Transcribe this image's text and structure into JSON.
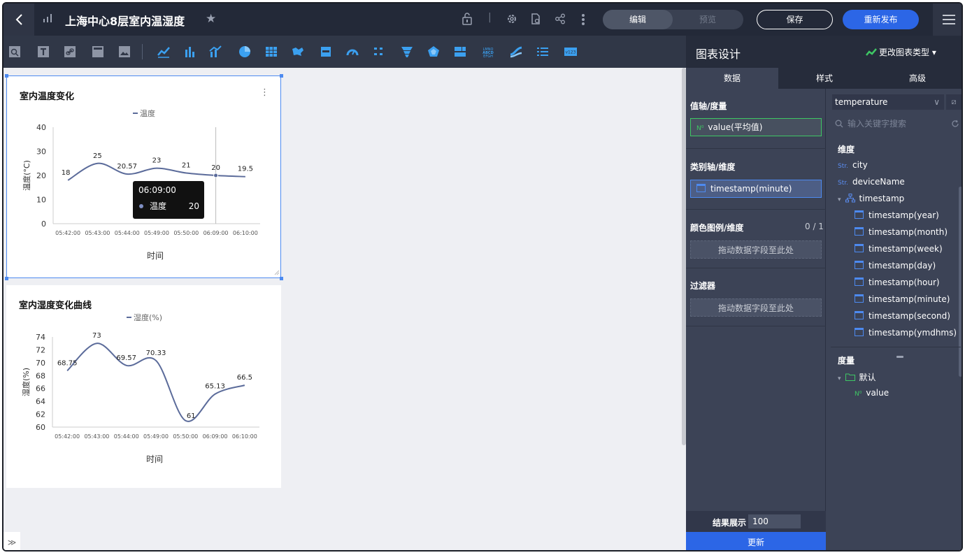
{
  "header": {
    "title": "上海中心8层室内温湿度",
    "edit_label": "编辑",
    "preview_label": "预览",
    "save_label": "保存",
    "republish_label": "重新发布"
  },
  "cards": [
    {
      "title": "室内温度变化",
      "legend": "温度",
      "y_axis_label": "温度(°C)",
      "x_axis_label": "时间",
      "tooltip": {
        "time": "06:09:00",
        "name": "温度",
        "value": "20"
      }
    },
    {
      "title": "室内湿度变化曲线",
      "legend": "湿度(%)",
      "y_axis_label": "湿度(%)",
      "x_axis_label": "时间"
    }
  ],
  "chart_data": [
    {
      "type": "line",
      "title": "室内温度变化",
      "legend": [
        "温度"
      ],
      "categories": [
        "05:42:00",
        "05:43:00",
        "05:44:00",
        "05:49:00",
        "05:50:00",
        "06:09:00",
        "06:10:00"
      ],
      "series": [
        {
          "name": "温度",
          "values": [
            18,
            25,
            20.57,
            23,
            21,
            20,
            19.5
          ]
        }
      ],
      "data_labels": [
        "18",
        "25",
        "20.57",
        "23",
        "21",
        "20",
        "19.5"
      ],
      "xlabel": "时间",
      "ylabel": "温度(°C)",
      "ylim": [
        0,
        40
      ],
      "yticks": [
        "0",
        "10",
        "20",
        "30",
        "40"
      ]
    },
    {
      "type": "line",
      "title": "室内湿度变化曲线",
      "legend": [
        "湿度(%)"
      ],
      "categories": [
        "05:42:00",
        "05:43:00",
        "05:44:00",
        "05:49:00",
        "05:50:00",
        "06:09:00",
        "06:10:00"
      ],
      "series": [
        {
          "name": "湿度(%)",
          "values": [
            68.75,
            73,
            69.57,
            70.33,
            61,
            65.13,
            66.5
          ]
        }
      ],
      "data_labels": [
        "68.75",
        "73",
        "69.57",
        "70.33",
        "61",
        "65.13",
        "66.5"
      ],
      "xlabel": "时间",
      "ylabel": "湿度(%)",
      "ylim": [
        60,
        74
      ],
      "yticks": [
        "60",
        "62",
        "64",
        "66",
        "68",
        "70",
        "72",
        "74"
      ]
    }
  ],
  "panel": {
    "title": "图表设计",
    "change_type": "更改图表类型",
    "tabs": [
      "数据",
      "样式",
      "高级"
    ],
    "value_axis": {
      "label": "值轴/度量",
      "field": "value(平均值)"
    },
    "category_axis": {
      "label": "类别轴/维度",
      "field": "timestamp(minute)"
    },
    "color_legend": {
      "label": "颜色图例/维度",
      "count": "0 / 1",
      "placeholder": "拖动数据字段至此处"
    },
    "filter": {
      "label": "过滤器",
      "placeholder": "拖动数据字段至此处"
    },
    "result": {
      "label": "结果展示",
      "value": "100"
    },
    "update_label": "更新",
    "dataset": "temperature",
    "search_placeholder": "输入关键字搜索",
    "dimensions_label": "维度",
    "dimensions": [
      {
        "tag": "Str.",
        "name": "city"
      },
      {
        "tag": "Str.",
        "name": "deviceName"
      },
      {
        "name": "timestamp"
      },
      {
        "name": "timestamp(year)"
      },
      {
        "name": "timestamp(month)"
      },
      {
        "name": "timestamp(week)"
      },
      {
        "name": "timestamp(day)"
      },
      {
        "name": "timestamp(hour)"
      },
      {
        "name": "timestamp(minute)"
      },
      {
        "name": "timestamp(second)"
      },
      {
        "name": "timestamp(ymdhms)"
      }
    ],
    "measures_label": "度量",
    "folder": "默认",
    "measures": [
      {
        "tag": "N⁰",
        "name": "value"
      }
    ]
  },
  "colors": {
    "accent": "#2c66e6",
    "line": "#5b6b9a",
    "green": "#3ec764",
    "topbar": "#232938",
    "panel": "#3c4356"
  }
}
